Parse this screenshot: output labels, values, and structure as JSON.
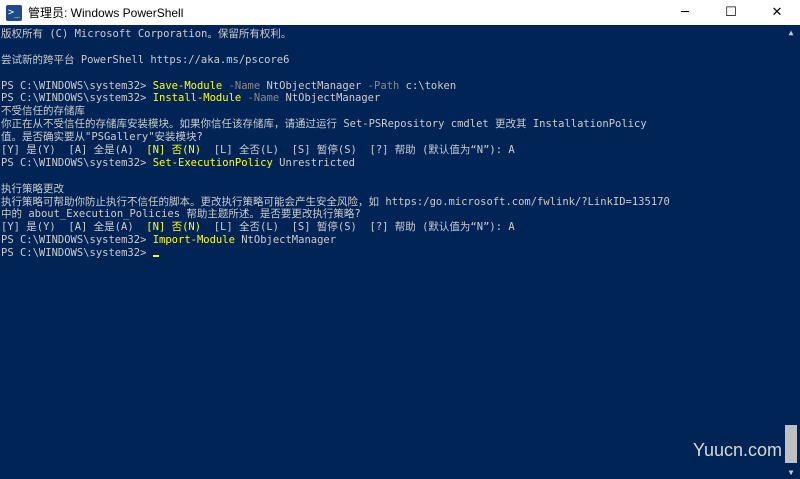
{
  "window": {
    "title": "管理员: Windows PowerShell",
    "minimize_glyph": "─",
    "maximize_glyph": "☐",
    "close_glyph": "✕"
  },
  "console": {
    "l1": "版权所有 (C) Microsoft Corporation。保留所有权利。",
    "l2": "",
    "l3": "尝试新的跨平台 PowerShell https://aka.ms/pscore6",
    "l4": "",
    "l5": {
      "prompt": "PS C:\\WINDOWS\\system32> ",
      "cmd": "Save-Module",
      "p1": " -Name",
      "v1": " NtObjectManager",
      "p2": " -Path",
      "v2": " c:\\token"
    },
    "l6": {
      "prompt": "PS C:\\WINDOWS\\system32> ",
      "cmd": "Install-Module",
      "p1": " -Name",
      "v1": " NtObjectManager"
    },
    "l7": "不受信任的存储库",
    "l8": "你正在从不受信任的存储库安装模块。如果你信任该存储库，请通过运行 Set-PSRepository cmdlet 更改其 InstallationPolicy",
    "l9": "值。是否确实要从\"PSGallery\"安装模块?",
    "l10": {
      "a": "[Y] 是(Y)  [A] 全是(A)  ",
      "b": "[N] 否(N)",
      "c": "  [L] 全否(L)  [S] 暂停(S)  [?] 帮助 (默认值为“N”): A"
    },
    "l11": {
      "prompt": "PS C:\\WINDOWS\\system32> ",
      "cmd": "Set-ExecutionPolicy",
      "v1": " Unrestricted"
    },
    "l12": "",
    "l13": "执行策略更改",
    "l14": "执行策略可帮助你防止执行不信任的脚本。更改执行策略可能会产生安全风险，如 https:/go.microsoft.com/fwlink/?LinkID=135170",
    "l15": "中的 about_Execution_Policies 帮助主题所述。是否要更改执行策略?",
    "l16": {
      "a": "[Y] 是(Y)  [A] 全是(A)  ",
      "b": "[N] 否(N)",
      "c": "  [L] 全否(L)  [S] 暂停(S)  [?] 帮助 (默认值为“N”): A"
    },
    "l17": {
      "prompt": "PS C:\\WINDOWS\\system32> ",
      "cmd": "Import-Module",
      "v1": " NtObjectManager"
    },
    "l18": {
      "prompt": "PS C:\\WINDOWS\\system32> "
    }
  },
  "watermark": "Yuucn.com",
  "colors": {
    "background": "#012456",
    "text": "#cccccc",
    "command": "#ffff00",
    "parameter": "#8a8a8a"
  }
}
